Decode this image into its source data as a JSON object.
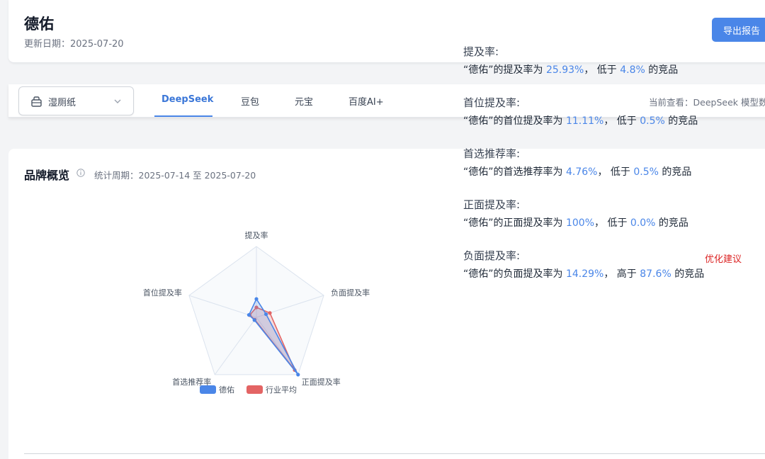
{
  "header": {
    "brand": "德佑",
    "update_date": "更新日期：2025-07-20",
    "export_label": "导出报告"
  },
  "toolbar": {
    "category": "湿厕纸",
    "tabs": [
      {
        "label": "DeepSeek",
        "active": true
      },
      {
        "label": "豆包",
        "active": false
      },
      {
        "label": "元宝",
        "active": false
      },
      {
        "label": "百度AI+",
        "active": false
      }
    ],
    "current_view": "当前查看：DeepSeek 模型数据"
  },
  "overview": {
    "title": "品牌概览",
    "period": "统计周期：2025-07-14 至 2025-07-20",
    "optimize_link": "优化建议"
  },
  "chart_data": {
    "type": "radar",
    "axes": [
      "提及率",
      "负面提及率",
      "正面提及率",
      "首选推荐率",
      "首位提及率"
    ],
    "max": 100,
    "series": [
      {
        "name": "德佑",
        "color": "#4a86e8",
        "values": [
          25.93,
          14.29,
          100,
          4.76,
          11.11
        ]
      },
      {
        "name": "行业平均",
        "color": "#e36464",
        "values": [
          14,
          20,
          92,
          4,
          10
        ]
      }
    ],
    "legend": "bottom"
  },
  "metrics": [
    {
      "title": "提及率:",
      "prefix": "“德佑”的提及率为 ",
      "value": "25.93%",
      "mid": "，  低于 ",
      "pct": "4.8%",
      "suffix": " 的竞品"
    },
    {
      "title": "首位提及率:",
      "prefix": "“德佑”的首位提及率为 ",
      "value": "11.11%",
      "mid": "，  低于 ",
      "pct": "0.5%",
      "suffix": " 的竞品"
    },
    {
      "title": "首选推荐率:",
      "prefix": "“德佑”的首选推荐率为 ",
      "value": "4.76%",
      "mid": "，  低于 ",
      "pct": "0.5%",
      "suffix": " 的竞品"
    },
    {
      "title": "正面提及率:",
      "prefix": "“德佑”的正面提及率为 ",
      "value": "100%",
      "mid": "，  低于 ",
      "pct": "0.0%",
      "suffix": " 的竞品"
    },
    {
      "title": "负面提及率:",
      "prefix": "“德佑”的负面提及率为 ",
      "value": "14.29%",
      "mid": "，  高于 ",
      "pct": "87.6%",
      "suffix": " 的竞品"
    }
  ]
}
